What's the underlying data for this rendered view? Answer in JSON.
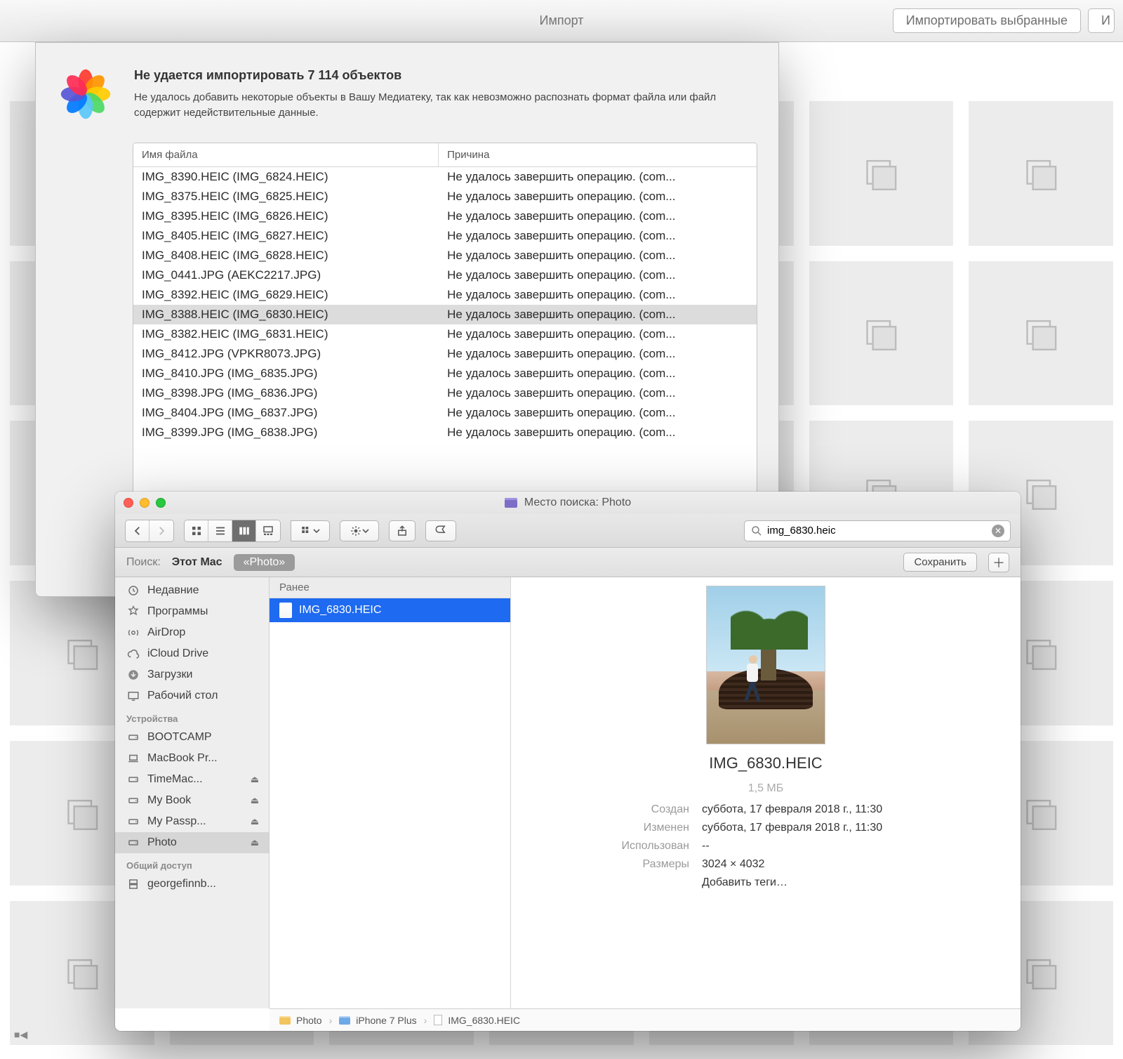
{
  "photos_app": {
    "title": "Импорт",
    "buttons": {
      "import_selected": "Импортировать выбранные",
      "import_truncated": "И"
    }
  },
  "dialog": {
    "title": "Не удается импортировать 7 114 объектов",
    "subtitle": "Не удалось добавить некоторые объекты в Вашу Медиатеку, так как невозможно распознать формат файла или файл содержит недействительные данные.",
    "col_name": "Имя файла",
    "col_reason": "Причина",
    "rows": [
      {
        "name": "IMG_8390.HEIC (IMG_6824.HEIC)",
        "reason": "Не удалось завершить операцию. (com..."
      },
      {
        "name": "IMG_8375.HEIC (IMG_6825.HEIC)",
        "reason": "Не удалось завершить операцию. (com..."
      },
      {
        "name": "IMG_8395.HEIC (IMG_6826.HEIC)",
        "reason": "Не удалось завершить операцию. (com..."
      },
      {
        "name": "IMG_8405.HEIC (IMG_6827.HEIC)",
        "reason": "Не удалось завершить операцию. (com..."
      },
      {
        "name": "IMG_8408.HEIC (IMG_6828.HEIC)",
        "reason": "Не удалось завершить операцию. (com..."
      },
      {
        "name": "IMG_0441.JPG (AEKC2217.JPG)",
        "reason": "Не удалось завершить операцию. (com..."
      },
      {
        "name": "IMG_8392.HEIC (IMG_6829.HEIC)",
        "reason": "Не удалось завершить операцию. (com..."
      },
      {
        "name": "IMG_8388.HEIC (IMG_6830.HEIC)",
        "reason": "Не удалось завершить операцию. (com...",
        "selected": true
      },
      {
        "name": "IMG_8382.HEIC (IMG_6831.HEIC)",
        "reason": "Не удалось завершить операцию. (com..."
      },
      {
        "name": "IMG_8412.JPG (VPKR8073.JPG)",
        "reason": "Не удалось завершить операцию. (com..."
      },
      {
        "name": "IMG_8410.JPG (IMG_6835.JPG)",
        "reason": "Не удалось завершить операцию. (com..."
      },
      {
        "name": "IMG_8398.JPG (IMG_6836.JPG)",
        "reason": "Не удалось завершить операцию. (com..."
      },
      {
        "name": "IMG_8404.JPG (IMG_6837.JPG)",
        "reason": "Не удалось завершить операцию. (com..."
      },
      {
        "name": "IMG_8399.JPG (IMG_6838.JPG)",
        "reason": "Не удалось завершить операцию. (com..."
      }
    ]
  },
  "finder": {
    "title_prefix": "Место поиска:",
    "title": "Photo",
    "search_value": "img_6830.heic",
    "scope": {
      "label": "Поиск:",
      "this_mac": "Этот Mac",
      "pill": "«Photo»",
      "save": "Сохранить"
    },
    "sidebar": {
      "favorites": [
        {
          "icon": "clock",
          "label": "Недавние"
        },
        {
          "icon": "apps",
          "label": "Программы"
        },
        {
          "icon": "airdrop",
          "label": "AirDrop"
        },
        {
          "icon": "cloud",
          "label": "iCloud Drive"
        },
        {
          "icon": "download",
          "label": "Загрузки"
        },
        {
          "icon": "desktop",
          "label": "Рабочий стол"
        }
      ],
      "devices_header": "Устройства",
      "devices": [
        {
          "icon": "hdd",
          "label": "BOOTCAMP"
        },
        {
          "icon": "laptop",
          "label": "MacBook Pr..."
        },
        {
          "icon": "hdd",
          "label": "TimeMac...",
          "eject": true
        },
        {
          "icon": "hdd",
          "label": "My Book",
          "eject": true
        },
        {
          "icon": "hdd",
          "label": "My Passp...",
          "eject": true
        },
        {
          "icon": "hdd",
          "label": "Photo",
          "eject": true,
          "selected": true
        }
      ],
      "shared_header": "Общий доступ",
      "shared": [
        {
          "icon": "server",
          "label": "georgefinnb..."
        }
      ]
    },
    "list": {
      "group": "Ранее",
      "item": "IMG_6830.HEIC"
    },
    "preview": {
      "name": "IMG_6830.HEIC",
      "size": "1,5 МБ",
      "created_k": "Создан",
      "created_v": "суббота, 17 февраля 2018 г., 11:30",
      "modified_k": "Изменен",
      "modified_v": "суббота, 17 февраля 2018 г., 11:30",
      "used_k": "Использован",
      "used_v": "--",
      "dim_k": "Размеры",
      "dim_v": "3024 × 4032",
      "add_tags": "Добавить теги…"
    },
    "path": [
      "Photo",
      "iPhone 7 Plus",
      "IMG_6830.HEIC"
    ]
  }
}
